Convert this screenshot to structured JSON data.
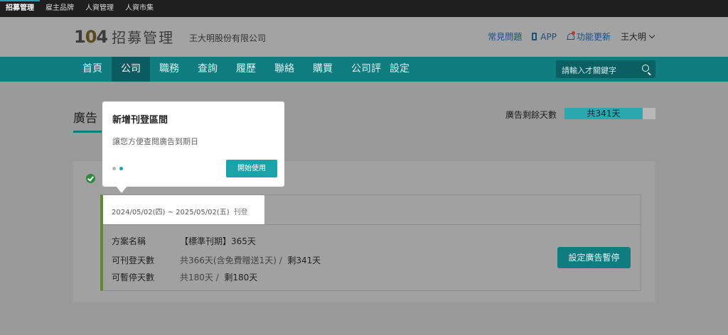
{
  "topbar": {
    "items": [
      "招募管理",
      "雇主品牌",
      "人資管理",
      "人資市集"
    ]
  },
  "header": {
    "logo_number": "104",
    "logo_title": "招募管理",
    "company": "王大明股份有限公司",
    "faq": "常見問題",
    "app": "APP",
    "updates": "功能更新",
    "user": "王大明"
  },
  "nav": {
    "items": [
      "首頁",
      "公司",
      "職務",
      "查詢",
      "履歷",
      "聯絡",
      "購買",
      "公司評",
      "設定"
    ],
    "active_index": 1,
    "search_placeholder": "請輸入才關鍵字"
  },
  "main": {
    "section_title": "廣告",
    "remain_label": "廣告剩餘天數",
    "remain_text": "共341天",
    "remain_fraction": 0.86,
    "card": {
      "period": "2024/05/02(四) ~ 2025/05/02(五)",
      "period_tag": "刊登",
      "plan_label": "方案名稱",
      "plan_value": "【標準刊期】365天",
      "publish_label": "可刊登天數",
      "publish_total": "共366天(含免費贈送1天) /",
      "publish_remaining": "剩341天",
      "pause_label": "可暫停天數",
      "pause_total": "共180天 /",
      "pause_remaining": "剩180天",
      "button": "設定廣告暫停"
    }
  },
  "popover": {
    "title": "新增刊登區間",
    "desc": "讓您方便查閱廣告到期日",
    "button": "開始使用",
    "active_step": 2
  },
  "colors": {
    "accent": "#1aa3a8",
    "nav_bg": "#0f7c80",
    "card_accent": "#5f8a2e"
  }
}
